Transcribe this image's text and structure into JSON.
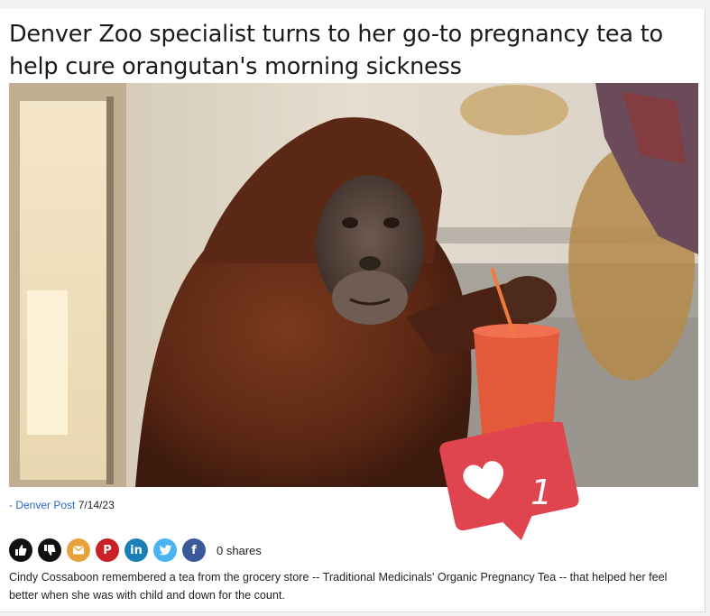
{
  "article": {
    "headline": "Denver Zoo specialist turns to her go-to pregnancy tea to help cure orangutan's morning sickness",
    "credit_source": "- Denver Post",
    "credit_date": "7/14/23",
    "body": "Cindy Cossaboon remembered a tea from the grocery store -- Traditional Medicinals' Organic Pregnancy Tea -- that helped her feel better when she was with child and down for the count."
  },
  "share_bar": {
    "buttons": [
      {
        "icon": "thumbs-up-icon",
        "color": "#111111"
      },
      {
        "icon": "thumbs-down-icon",
        "color": "#111111"
      },
      {
        "icon": "email-icon",
        "color": "#e8a23a"
      },
      {
        "icon": "pinterest-icon",
        "color": "#cb2027",
        "glyph": "P"
      },
      {
        "icon": "linkedin-icon",
        "color": "#1a7fb5",
        "glyph": "in"
      },
      {
        "icon": "twitter-icon",
        "color": "#4ab3f4"
      },
      {
        "icon": "facebook-icon",
        "color": "#3b5998",
        "glyph": "f"
      }
    ],
    "shares_text": "0 shares"
  },
  "like_badge": {
    "count": "1",
    "color": "#e0454f",
    "icon": "heart-icon"
  },
  "colors": {
    "link": "#2b66c5",
    "text": "#222222"
  }
}
